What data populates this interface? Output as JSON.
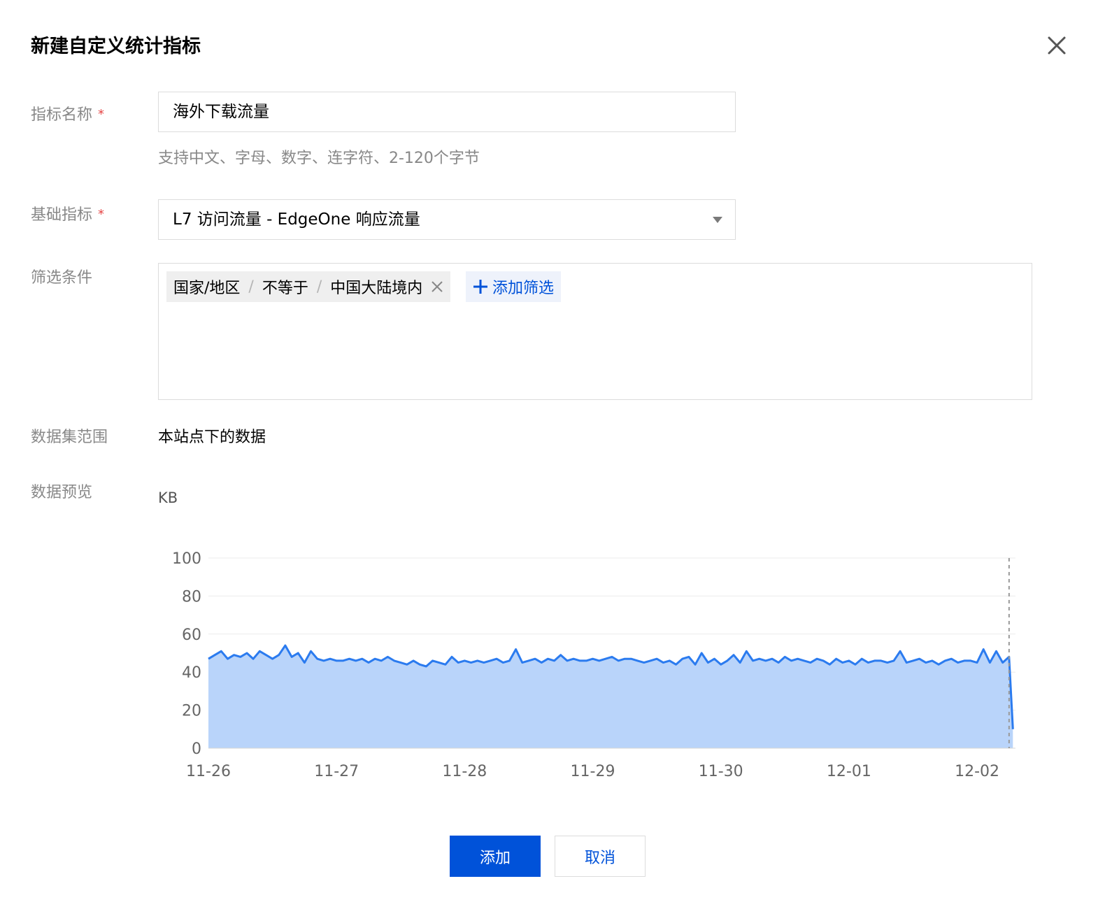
{
  "dialog": {
    "title": "新建自定义统计指标",
    "close_icon": "close-icon"
  },
  "form": {
    "metric_name": {
      "label": "指标名称",
      "required_mark": "*",
      "value": "海外下载流量",
      "hint": "支持中文、字母、数字、连字符、2-120个字节"
    },
    "base_metric": {
      "label": "基础指标",
      "required_mark": "*",
      "value": "L7 访问流量 - EdgeOne 响应流量"
    },
    "filters": {
      "label": "筛选条件",
      "items": [
        {
          "field": "国家/地区",
          "operator": "不等于",
          "value": "中国大陆境内"
        }
      ],
      "separator": "/",
      "add_label": "添加筛选"
    },
    "scope": {
      "label": "数据集范围",
      "value": "本站点下的数据"
    },
    "preview": {
      "label": "数据预览",
      "unit": "KB"
    }
  },
  "buttons": {
    "confirm": "添加",
    "cancel": "取消"
  },
  "colors": {
    "primary": "#0052d9",
    "line": "#2b7bef",
    "area": "#b9d4fa",
    "required": "#e54545"
  },
  "chart_data": {
    "type": "area",
    "ylabel": "KB",
    "ylim": [
      0,
      100
    ],
    "yticks": [
      0,
      20,
      40,
      60,
      80,
      100
    ],
    "xlim": [
      0,
      6.3
    ],
    "xtick_labels": [
      "11-26",
      "11-27",
      "11-28",
      "11-29",
      "11-30",
      "12-01",
      "12-02"
    ],
    "xtick_positions": [
      0,
      1,
      2,
      3,
      4,
      5,
      6
    ],
    "grid": true,
    "marker_x": 6.25,
    "series": [
      {
        "x": [
          0,
          0.05,
          0.1,
          0.15,
          0.2,
          0.25,
          0.3,
          0.35,
          0.4,
          0.45,
          0.5,
          0.55,
          0.6,
          0.65,
          0.7,
          0.75,
          0.8,
          0.85,
          0.9,
          0.95,
          1,
          1.05,
          1.1,
          1.15,
          1.2,
          1.25,
          1.3,
          1.35,
          1.4,
          1.45,
          1.5,
          1.55,
          1.6,
          1.65,
          1.7,
          1.75,
          1.8,
          1.85,
          1.9,
          1.95,
          2,
          2.05,
          2.1,
          2.15,
          2.2,
          2.25,
          2.3,
          2.35,
          2.4,
          2.45,
          2.5,
          2.55,
          2.6,
          2.65,
          2.7,
          2.75,
          2.8,
          2.85,
          2.9,
          2.95,
          3,
          3.05,
          3.1,
          3.15,
          3.2,
          3.25,
          3.3,
          3.35,
          3.4,
          3.45,
          3.5,
          3.55,
          3.6,
          3.65,
          3.7,
          3.75,
          3.8,
          3.85,
          3.9,
          3.95,
          4,
          4.05,
          4.1,
          4.15,
          4.2,
          4.25,
          4.3,
          4.35,
          4.4,
          4.45,
          4.5,
          4.55,
          4.6,
          4.65,
          4.7,
          4.75,
          4.8,
          4.85,
          4.9,
          4.95,
          5,
          5.05,
          5.1,
          5.15,
          5.2,
          5.25,
          5.3,
          5.35,
          5.4,
          5.45,
          5.5,
          5.55,
          5.6,
          5.65,
          5.7,
          5.75,
          5.8,
          5.85,
          5.9,
          5.95,
          6,
          6.05,
          6.1,
          6.15,
          6.2,
          6.25,
          6.28
        ],
        "y": [
          47,
          49,
          51,
          47,
          49,
          48,
          50,
          47,
          51,
          49,
          47,
          49,
          54,
          48,
          50,
          45,
          51,
          47,
          46,
          47,
          46,
          46,
          47,
          46,
          47,
          45,
          47,
          46,
          48,
          46,
          45,
          44,
          46,
          44,
          43,
          46,
          45,
          44,
          48,
          45,
          46,
          45,
          46,
          45,
          46,
          47,
          45,
          46,
          52,
          45,
          46,
          47,
          45,
          47,
          46,
          49,
          46,
          47,
          46,
          46,
          47,
          46,
          47,
          48,
          46,
          47,
          47,
          46,
          45,
          46,
          47,
          45,
          46,
          44,
          47,
          48,
          44,
          50,
          45,
          47,
          44,
          46,
          49,
          45,
          51,
          46,
          47,
          46,
          47,
          45,
          48,
          46,
          47,
          46,
          45,
          47,
          46,
          44,
          47,
          45,
          46,
          44,
          47,
          45,
          46,
          46,
          45,
          46,
          51,
          45,
          46,
          47,
          45,
          46,
          44,
          46,
          47,
          45,
          46,
          46,
          45,
          52,
          45,
          51,
          45,
          48,
          10
        ]
      }
    ]
  }
}
